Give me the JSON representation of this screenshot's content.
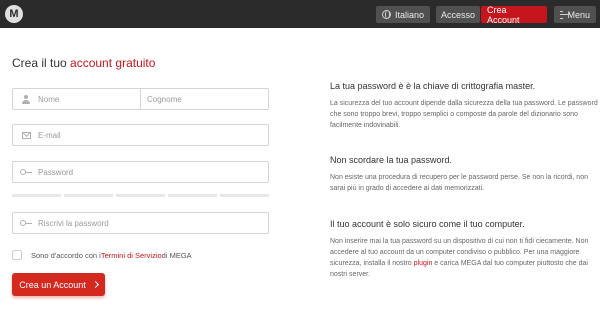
{
  "header": {
    "logo_letter": "M",
    "language": "Italiano",
    "login": "Accesso",
    "create_account": "Crea Account",
    "menu": "Menu"
  },
  "form": {
    "title_prefix": "Crea il tuo ",
    "title_accent": "account gratuito",
    "name_placeholder": "Nome",
    "surname_placeholder": "Cognome",
    "email_placeholder": "E-mail",
    "password_placeholder": "Password",
    "repeat_placeholder": "Riscrivi la password",
    "terms_prefix": "Sono d'accordo con i ",
    "terms_link": "Termini di Servizio",
    "terms_suffix": " di MEGA",
    "submit": "Crea un Account"
  },
  "info": {
    "h1": "La tua password è è la chiave di crittografia master.",
    "p1": "La sicurezza del tuo account dipende dalla sicurezza della tua password. Le password che sono troppo brevi, troppo semplici o composte da parole del dizionario sono facilmente indovinabili.",
    "h2": "Non scordare la tua password.",
    "p2": "Non esiste una procedura di recupero per le password perse. Se non la ricordi, non sarai più in grado di accedere ai dati memorizzati.",
    "h3": "Il tuo account è solo sicuro come il tuo computer.",
    "p3_before": "Non inserire mai la tua password su un dispositivo di cui non ti fidi ciecamente. Non accedere al tuo account da un computer condiviso o pubblico. Per una maggiore sicurezza, installa il nostro ",
    "p3_link": "plugin",
    "p3_after": " e carica MEGA dal tuo computer piuttosto che dai nostri server."
  },
  "colors": {
    "accent": "#c4161c",
    "topbar": "#2b2b2b"
  }
}
